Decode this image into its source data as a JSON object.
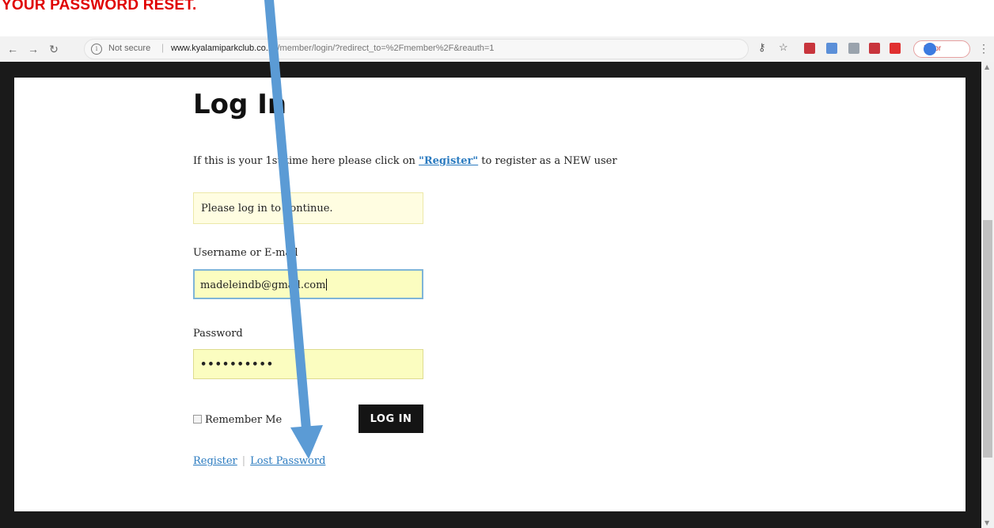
{
  "instruction": {
    "text": "YOUR PASSWORD RESET."
  },
  "browser": {
    "security_label": "Not secure",
    "url_host": "www.kyalamiparkclub.co.za",
    "url_path": "/member/login/?redirect_to=%2Fmember%2F&reauth=1",
    "error_label": "Error",
    "icons": [
      "back-icon",
      "forward-icon",
      "reload-icon",
      "info-icon",
      "key-icon",
      "star-icon",
      "extension-icon",
      "profile-avatar",
      "menu-icon"
    ],
    "extension_colors": [
      "#c8353d",
      "#5b8fd8",
      "#9aa3ad",
      "#c8353d",
      "#e03030"
    ]
  },
  "page": {
    "title": "Log In",
    "intro_before": "If this is your 1st time here please click on ",
    "intro_link": "\"Register\"",
    "intro_after": " to register as a NEW user",
    "notice": "Please log in to continue.",
    "username_label": "Username or E-mail",
    "username_value": "madeleindb@gmail.com",
    "password_label": "Password",
    "password_value": "••••••••••",
    "remember_label": "Remember Me",
    "login_button": "LOG IN",
    "register_link": "Register",
    "separator": "|",
    "lost_password_link": "Lost Password"
  },
  "colors": {
    "instruction_red": "#e00000",
    "link_blue": "#2b7bc0",
    "arrow_blue": "#5b9bd5",
    "field_yellow": "#fbfdc0"
  }
}
